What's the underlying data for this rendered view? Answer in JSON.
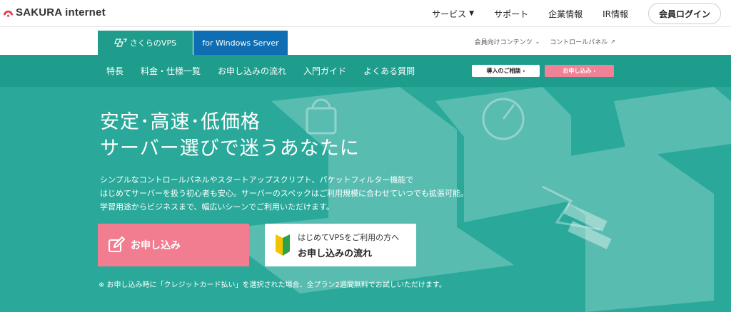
{
  "header": {
    "logo_text": "SAKURA internet",
    "nav": [
      {
        "label": "サービス",
        "has_dropdown": true
      },
      {
        "label": "サポート"
      },
      {
        "label": "企業情報"
      },
      {
        "label": "IR情報"
      }
    ],
    "login_label": "会員ログイン"
  },
  "product_tabs": {
    "vps_label": "さくらのVPS",
    "windows_label": "for Windows Server"
  },
  "subnav": {
    "members_label": "会員向けコンテンツ",
    "control_panel_label": "コントロールパネル"
  },
  "menu": {
    "items": [
      "特長",
      "料金・仕様一覧",
      "お申し込みの流れ",
      "入門ガイド",
      "よくある質問"
    ],
    "consult_label": "導入のご相談 ›",
    "apply_label": "お申し込み ›"
  },
  "hero": {
    "headline_1": "安定･高速･低価格",
    "headline_2": "サーバー選びで迷うあなたに",
    "lead_1": "シンプルなコントロールパネルやスタートアップスクリプト、パケットフィルター機能で",
    "lead_2": "はじめてサーバーを扱う初心者も安心。サーバーのスペックはご利用規模に合わせていつでも拡張可能。",
    "lead_3": "学習用途からビジネスまで、幅広いシーンでご利用いただけます。",
    "apply_button": "お申し込み",
    "guide_sub": "はじめてVPSをご利用の方へ",
    "guide_main": "お申し込みの流れ",
    "note": "※ お申し込み時に「クレジットカード払い」を選択された場合、全プラン2週間無料でお試しいただけます。"
  },
  "colors": {
    "brand_green": "#1e9d8d",
    "hero_green": "#2aa99a",
    "windows_blue": "#0f6eb3",
    "pink": "#f27d90"
  }
}
